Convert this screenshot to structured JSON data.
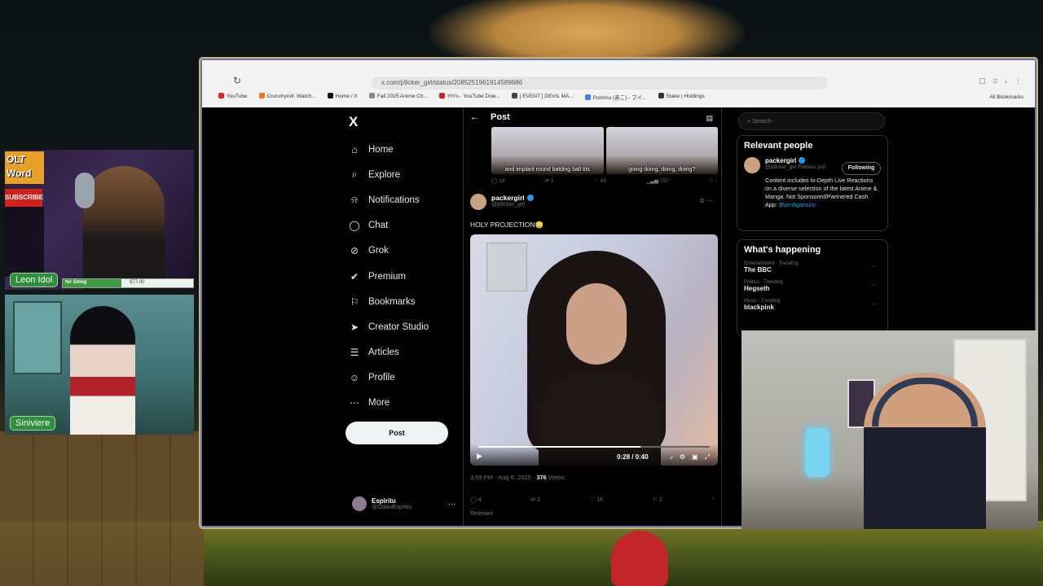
{
  "browser": {
    "url": "x.com/p9cker_girl/status/2085251961914589686",
    "bookmarks": [
      {
        "label": "YouTube",
        "color": "#e62117"
      },
      {
        "label": "Crunchyroll: Watch...",
        "color": "#f47521"
      },
      {
        "label": "Home / X",
        "color": "#111111"
      },
      {
        "label": "Fall 2025 Anime Ch...",
        "color": "#888888"
      },
      {
        "label": "YtYs - YouTube Dow...",
        "color": "#cc2222"
      },
      {
        "label": "[ EVENT ] DEVIL MA...",
        "color": "#444444"
      },
      {
        "label": "Pommu (赤こ) - ブイ...",
        "color": "#3b82f6"
      },
      {
        "label": "Stake | Holdings",
        "color": "#333333"
      }
    ],
    "all_bookmarks": "All Bookmarks"
  },
  "x": {
    "logo": "X",
    "nav": [
      {
        "label": "Home",
        "icon": "⌂",
        "name": "home"
      },
      {
        "label": "Explore",
        "icon": "⌕",
        "name": "explore"
      },
      {
        "label": "Notifications",
        "icon": "⍾",
        "name": "notifications"
      },
      {
        "label": "Chat",
        "icon": "◯",
        "name": "chat"
      },
      {
        "label": "Grok",
        "icon": "⊘",
        "name": "grok"
      },
      {
        "label": "Premium",
        "icon": "✔",
        "name": "premium"
      },
      {
        "label": "Bookmarks",
        "icon": "⚐",
        "name": "bookmarks"
      },
      {
        "label": "Creator Studio",
        "icon": "➤",
        "name": "creator-studio"
      },
      {
        "label": "Articles",
        "icon": "☰",
        "name": "articles"
      },
      {
        "label": "Profile",
        "icon": "☺",
        "name": "profile"
      },
      {
        "label": "More",
        "icon": "⋯",
        "name": "more"
      }
    ],
    "post_button": "Post",
    "account": {
      "name": "Espiritu",
      "handle": "@OtakuEspiritu"
    },
    "header_title": "Post",
    "prev_tweet": {
      "captions": [
        "and implant round balding ball tits",
        "going doing, doing, doing?"
      ],
      "actions": [
        "10",
        "1",
        "43",
        "757"
      ]
    },
    "tweet": {
      "name": "packergirl",
      "handle": "@p9cker_girl",
      "text": "HOLY PROJECTION😳",
      "video_time": "0:28 / 0:40",
      "video_progress": 0.7,
      "time": "3:59 PM · Aug 6, 2025 ·",
      "views_count": "376",
      "views_label": "Views",
      "replies": "4",
      "reposts": "2",
      "likes": "15",
      "bookmarks": "1",
      "relevant_label": "Relevant"
    },
    "search_placeholder": "Search",
    "relevant_people": {
      "title": "Relevant people",
      "name": "packergirl",
      "handle": "@p9cker_girl",
      "follows_you": "Follows you",
      "following": "Following",
      "bio": "Content includes In-Depth Live Reactions on a diverse selection of the latest Anime & Manga. Not Sponsored/Partnered Cash App:",
      "bio_link": "$Nerdigansinc"
    },
    "whats_happening": {
      "title": "What's happening",
      "trends": [
        {
          "category": "Entertainment · Trending",
          "title": "The BBC"
        },
        {
          "category": "Politics · Trending",
          "title": "Hegseth"
        },
        {
          "category": "Music · Trending",
          "title": "blackpink"
        }
      ]
    }
  },
  "overlay": {
    "streamer1": "Leon Idol",
    "streamer2": "Siniviere",
    "badge_word": "OLT Word",
    "subscribe": "SUBSCRIBE",
    "donation_text": "for Smug",
    "donation_amount": "$77.00",
    "donation_progress": 0.45
  }
}
